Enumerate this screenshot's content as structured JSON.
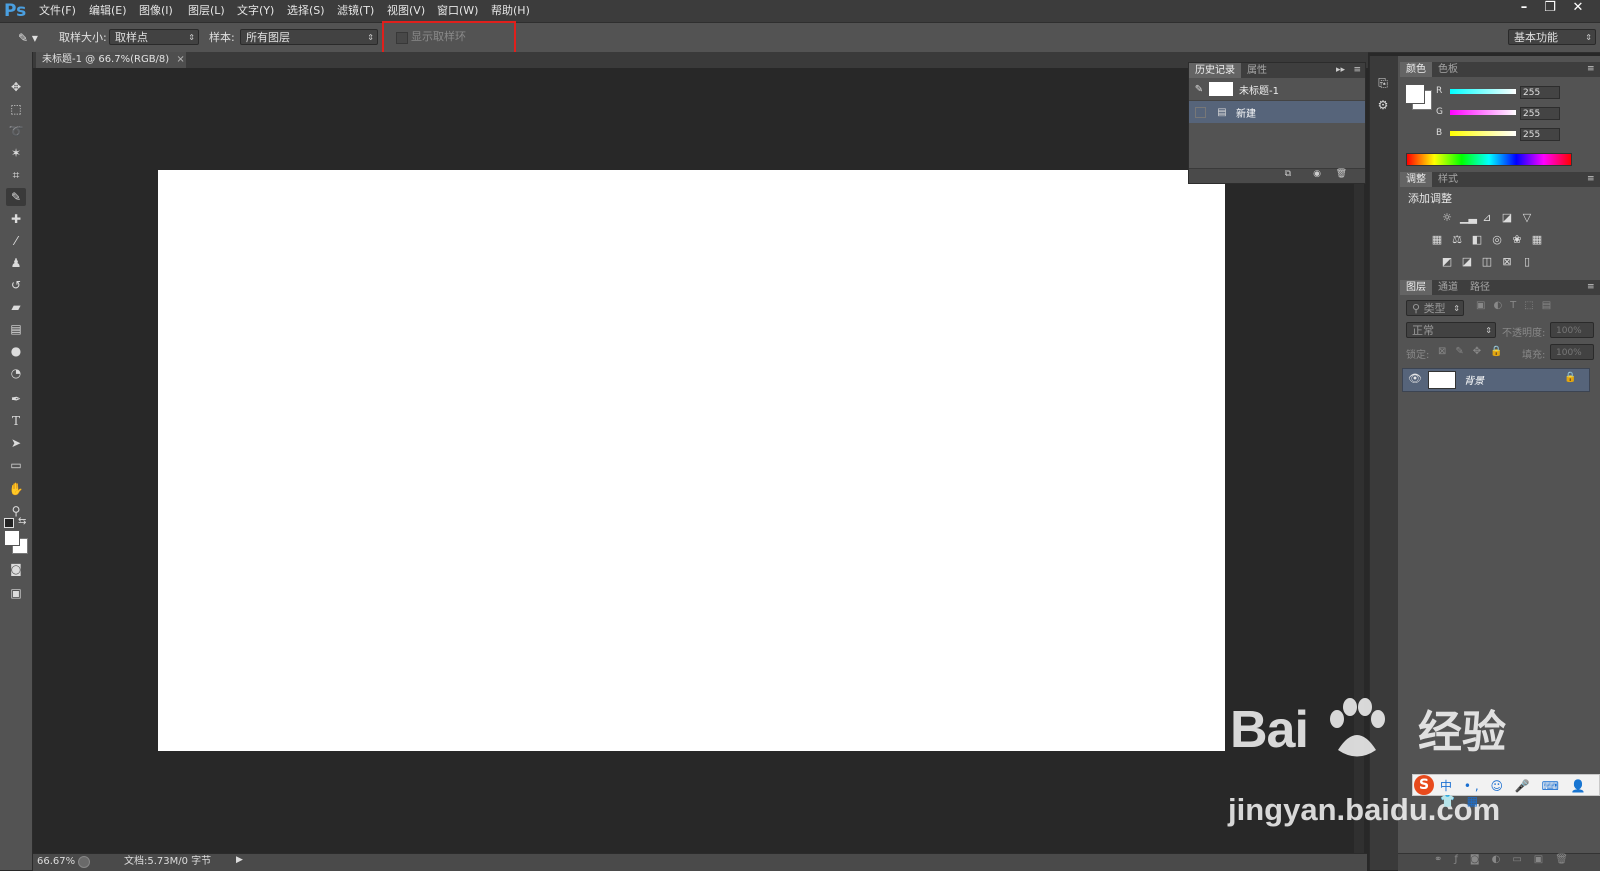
{
  "app": {
    "logo": "Ps"
  },
  "menu": [
    "文件(F)",
    "编辑(E)",
    "图像(I)",
    "图层(L)",
    "文字(Y)",
    "选择(S)",
    "滤镜(T)",
    "视图(V)",
    "窗口(W)",
    "帮助(H)"
  ],
  "window_controls": {
    "minimize": "–",
    "restore": "❐",
    "close": "✕"
  },
  "options": {
    "sample_size_label": "取样大小:",
    "sample_size_value": "取样点",
    "sample_label": "样本:",
    "sample_value": "所有图层",
    "show_ring_label": "显示取样环",
    "show_ring_checked": false,
    "workspace": "基本功能"
  },
  "document": {
    "tab_title": "未标题-1 @ 66.7%(RGB/8)",
    "close": "×"
  },
  "status": {
    "zoom": "66.67%",
    "doc_info": "文档:5.73M/0 字节"
  },
  "history": {
    "tabs": [
      "历史记录",
      "属性"
    ],
    "snapshot_name": "未标题-1",
    "items": [
      "新建"
    ]
  },
  "color_panel": {
    "tabs": [
      "颜色",
      "色板"
    ],
    "channels": [
      {
        "label": "R",
        "value": "255"
      },
      {
        "label": "G",
        "value": "255"
      },
      {
        "label": "B",
        "value": "255"
      }
    ],
    "foreground": "#ffffff"
  },
  "adjustments": {
    "tabs": [
      "调整",
      "样式"
    ],
    "title": "添加调整"
  },
  "layers": {
    "tabs": [
      "图层",
      "通道",
      "路径"
    ],
    "filter_kind": "类型",
    "blend_mode": "正常",
    "opacity_label": "不透明度:",
    "opacity_value": "100%",
    "lock_label": "锁定:",
    "fill_label": "填充:",
    "fill_value": "100%",
    "layer_name": "背景"
  },
  "watermark": {
    "brand": "Bai",
    "brand_cn": "经验",
    "url": "jingyan.baidu.com"
  },
  "colors": {
    "accent_highlight": "#e0201c",
    "ps_blue": "#4a9fe0",
    "selected_row": "#56647a"
  }
}
